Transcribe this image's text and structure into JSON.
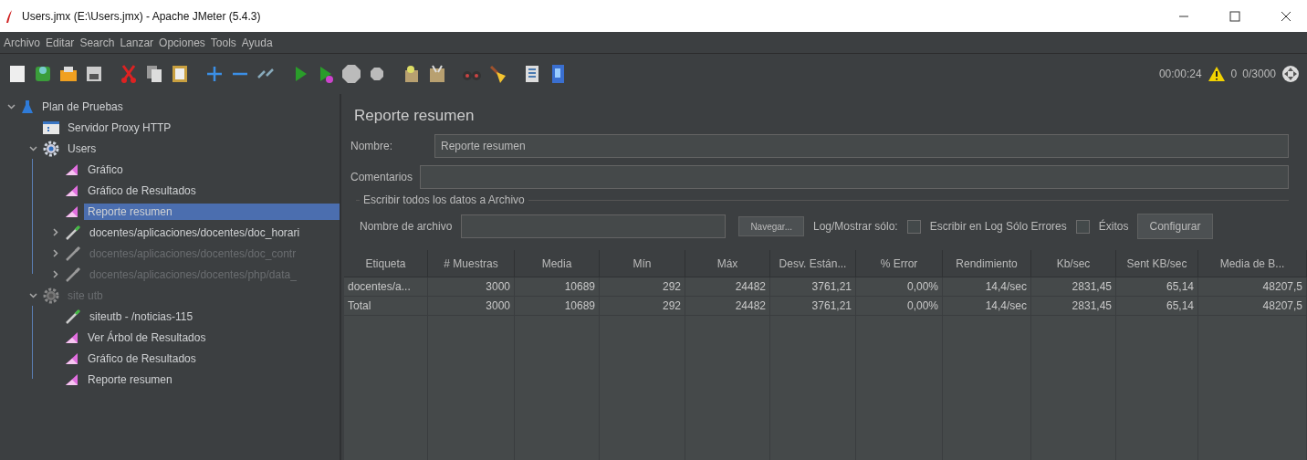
{
  "window": {
    "title": "Users.jmx (E:\\Users.jmx) - Apache JMeter (5.4.3)"
  },
  "menu": [
    "Archivo",
    "Editar",
    "Search",
    "Lanzar",
    "Opciones",
    "Tools",
    "Ayuda"
  ],
  "status": {
    "elapsed": "00:00:24",
    "warnings": "0",
    "threads": "0/3000"
  },
  "tree": [
    {
      "label": "Plan de Pruebas",
      "kind": "plan",
      "expanded": true,
      "disabled": false,
      "selected": false,
      "children": [
        {
          "label": "Servidor Proxy HTTP",
          "kind": "proxy",
          "disabled": false,
          "selected": false
        },
        {
          "label": "Users",
          "kind": "group",
          "expanded": true,
          "disabled": false,
          "selected": false,
          "children": [
            {
              "label": "Gráfico",
              "kind": "listener",
              "disabled": false,
              "selected": false
            },
            {
              "label": "Gráfico de Resultados",
              "kind": "listener",
              "disabled": false,
              "selected": false
            },
            {
              "label": "Reporte resumen",
              "kind": "listener",
              "disabled": false,
              "selected": true
            },
            {
              "label": "docentes/aplicaciones/docentes/doc_horari",
              "kind": "sampler",
              "expanded": false,
              "disabled": false,
              "selected": false
            },
            {
              "label": "docentes/aplicaciones/docentes/doc_contr",
              "kind": "sampler",
              "expanded": false,
              "disabled": true,
              "selected": false
            },
            {
              "label": "docentes/aplicaciones/docentes/php/data_",
              "kind": "sampler",
              "expanded": false,
              "disabled": true,
              "selected": false
            }
          ]
        },
        {
          "label": "site utb",
          "kind": "group",
          "expanded": true,
          "disabled": true,
          "selected": false,
          "children": [
            {
              "label": "siteutb - /noticias-115",
              "kind": "sampler",
              "disabled": false,
              "selected": false
            },
            {
              "label": "Ver Árbol de Resultados",
              "kind": "listener",
              "disabled": false,
              "selected": false
            },
            {
              "label": "Gráfico de Resultados",
              "kind": "listener",
              "disabled": false,
              "selected": false
            },
            {
              "label": "Reporte resumen",
              "kind": "listener",
              "disabled": false,
              "selected": false
            }
          ]
        }
      ]
    }
  ],
  "panel": {
    "title": "Reporte resumen",
    "name_label": "Nombre:",
    "name_value": "Reporte resumen",
    "comments_label": "Comentarios",
    "file_group": "Escribir todos los datos a Archivo",
    "file_label": "Nombre de archivo",
    "browse_button": "Navegar...",
    "log_label": "Log/Mostrar sólo:",
    "options": [
      {
        "label": "Escribir en Log Sólo Errores",
        "checked": false
      },
      {
        "label": "Éxitos",
        "checked": false
      }
    ],
    "configure_button": "Configurar"
  },
  "table": {
    "columns": [
      "Etiqueta",
      "# Muestras",
      "Media",
      "Mín",
      "Máx",
      "Desv. Están...",
      "% Error",
      "Rendimiento",
      "Kb/sec",
      "Sent KB/sec",
      "Media de B..."
    ],
    "rows": [
      [
        "docentes/a...",
        "3000",
        "10689",
        "292",
        "24482",
        "3761,21",
        "0,00%",
        "14,4/sec",
        "2831,45",
        "65,14",
        "48207,5"
      ],
      [
        "Total",
        "3000",
        "10689",
        "292",
        "24482",
        "3761,21",
        "0,00%",
        "14,4/sec",
        "2831,45",
        "65,14",
        "48207,5"
      ]
    ]
  }
}
